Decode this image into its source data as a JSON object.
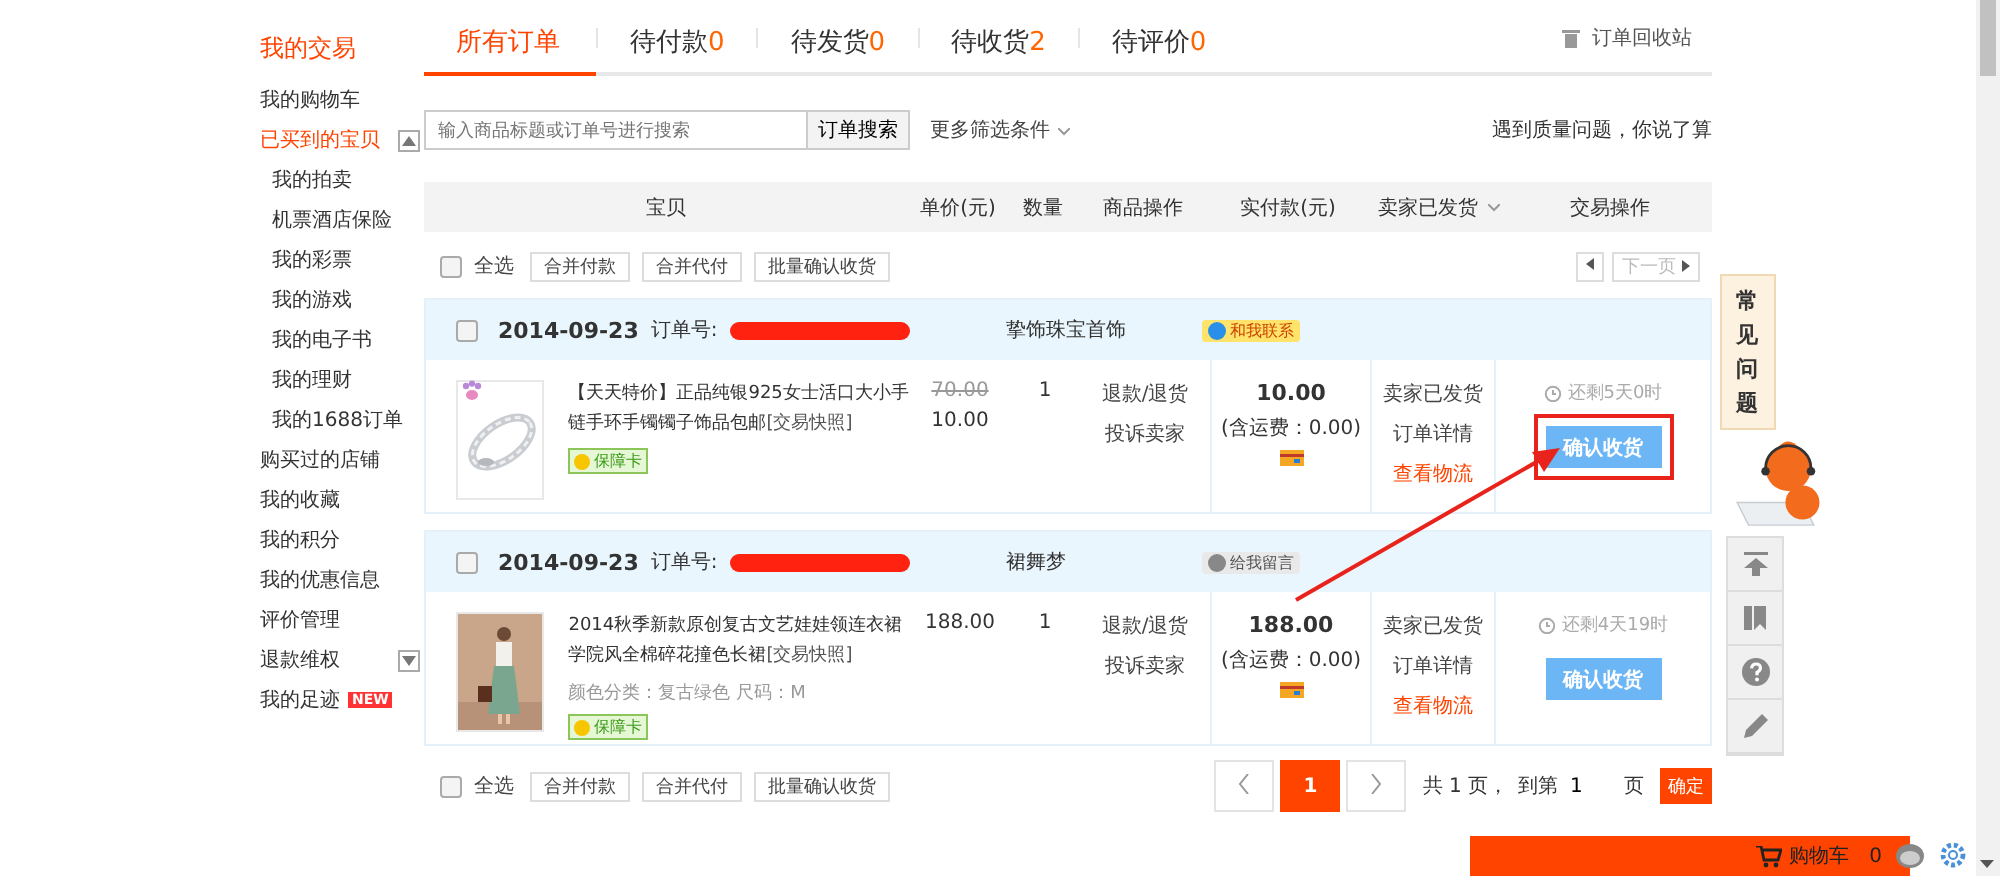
{
  "sidebar": {
    "title": "我的交易",
    "items": [
      {
        "label": "我的购物车",
        "kind": "link",
        "selected": false
      },
      {
        "label": "已买到的宝贝",
        "kind": "group",
        "selected": true,
        "expanded": true,
        "children": [
          {
            "label": "我的拍卖"
          },
          {
            "label": "机票酒店保险"
          },
          {
            "label": "我的彩票"
          },
          {
            "label": "我的游戏"
          },
          {
            "label": "我的电子书"
          },
          {
            "label": "我的理财"
          },
          {
            "label": "我的1688订单"
          }
        ]
      },
      {
        "label": "购买过的店铺",
        "kind": "link",
        "selected": false
      },
      {
        "label": "我的收藏",
        "kind": "link",
        "selected": false
      },
      {
        "label": "我的积分",
        "kind": "link",
        "selected": false
      },
      {
        "label": "我的优惠信息",
        "kind": "link",
        "selected": false
      },
      {
        "label": "评价管理",
        "kind": "link",
        "selected": false
      },
      {
        "label": "退款维权",
        "kind": "group",
        "selected": false,
        "expanded": false
      },
      {
        "label": "我的足迹",
        "kind": "link",
        "selected": false,
        "badge": "NEW"
      }
    ]
  },
  "tabs": [
    {
      "label": "所有订单",
      "selected": true
    },
    {
      "label": "待付款",
      "count": "0",
      "selected": false
    },
    {
      "label": "待发货",
      "count": "0",
      "selected": false
    },
    {
      "label": "待收货",
      "count": "2",
      "selected": false
    },
    {
      "label": "待评价",
      "count": "0",
      "selected": false
    }
  ],
  "recycle_bin": "订单回收站",
  "search": {
    "placeholder": "输入商品标题或订单号进行搜索",
    "button": "订单搜索",
    "filter": "更多筛选条件",
    "notice": "遇到质量问题，你说了算"
  },
  "columns": [
    "宝贝",
    "单价(元)",
    "数量",
    "商品操作",
    "实付款(元)",
    "卖家已发货",
    "交易操作"
  ],
  "toolbar": {
    "select_all": "全选",
    "checked": false,
    "buttons": [
      "合并付款",
      "合并代付",
      "批量确认收货"
    ]
  },
  "top_pager": {
    "next": "下一页",
    "disabled": true
  },
  "orders": [
    {
      "date": "2014-09-23",
      "order_label": "订单号:",
      "shop": "挚饰珠宝首饰",
      "contact": {
        "kind": "online",
        "label": "和我联系"
      },
      "checked": false,
      "title": "【天天特价】正品纯银925女士活口大小手链手环手镯镯子饰品包邮",
      "snapshot": "[交易快照]",
      "picture": {
        "kind": "picture"
      },
      "badge": "保障卡",
      "original_price": "70.00",
      "price": "10.00",
      "quantity": "1",
      "actions": [
        "退款/退货",
        "投诉卖家"
      ],
      "paid": "10.00",
      "shipping": "(含运费：0.00)",
      "status": [
        "卖家已发货",
        "订单详情"
      ],
      "logistics": "查看物流",
      "countdown": "还剩5天0时",
      "confirm": "确认收货",
      "highlighted": true
    },
    {
      "date": "2014-09-23",
      "order_label": "订单号:",
      "shop": "裙舞梦",
      "contact": {
        "kind": "offline",
        "label": "给我留言"
      },
      "checked": false,
      "title": "2014秋季新款原创复古文艺娃娃领连衣裙学院风全棉碎花撞色长裙",
      "snapshot": "[交易快照]",
      "picture": {
        "kind": "picture"
      },
      "sku": "颜色分类：复古绿色  尺码：M",
      "badge": "保障卡",
      "price": "188.00",
      "quantity": "1",
      "actions": [
        "退款/退货",
        "投诉卖家"
      ],
      "paid": "188.00",
      "shipping": "(含运费：0.00)",
      "status": [
        "卖家已发货",
        "订单详情"
      ],
      "logistics": "查看物流",
      "countdown": "还剩4天19时",
      "confirm": "确认收货",
      "highlighted": false
    }
  ],
  "bottom_toolbar": {
    "select_all": "全选",
    "checked": false,
    "buttons": [
      "合并付款",
      "合并代付",
      "批量确认收货"
    ]
  },
  "pager": {
    "pages": [
      {
        "label": "1",
        "selected": true
      }
    ],
    "total": "共 1 页，",
    "goto": "到第",
    "value": "1",
    "unit": "页",
    "confirm": "确定"
  },
  "help": {
    "label": "常见问题"
  },
  "cart_bar": {
    "label": "购物车",
    "count": "0"
  }
}
